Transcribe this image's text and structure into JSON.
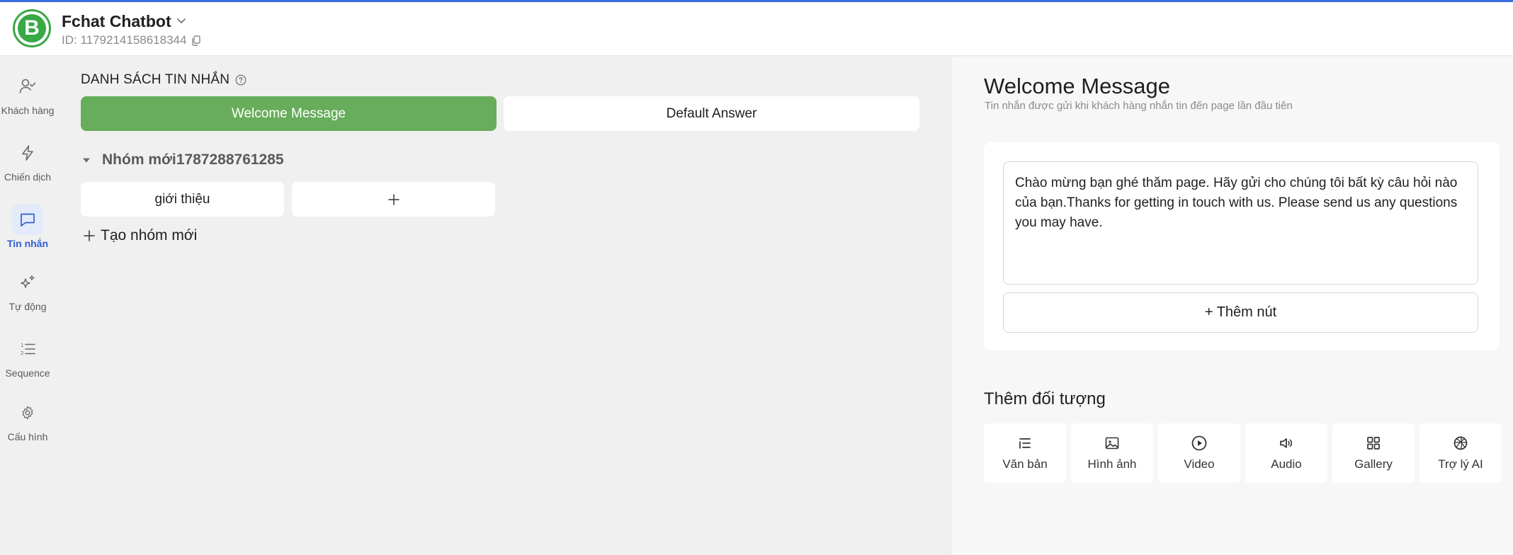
{
  "header": {
    "app_name": "Fchat Chatbot",
    "app_id": "ID: 1179214158618344",
    "logo_letter": "B"
  },
  "nav": {
    "items": [
      {
        "label": "Khách hàng",
        "icon": "user-check-icon",
        "active": false
      },
      {
        "label": "Chiến dịch",
        "icon": "lightning-icon",
        "active": false
      },
      {
        "label": "Tin nhắn",
        "icon": "message-icon",
        "active": true
      },
      {
        "label": "Tự động",
        "icon": "sparkles-icon",
        "active": false
      },
      {
        "label": "Sequence",
        "icon": "numbered-list-icon",
        "active": false
      },
      {
        "label": "Cấu hình",
        "icon": "gear-icon",
        "active": false
      }
    ]
  },
  "messages_panel": {
    "title": "DANH SÁCH TIN NHẮN",
    "tabs": [
      {
        "label": "Welcome Message",
        "active": true
      },
      {
        "label": "Default Answer",
        "active": false
      }
    ],
    "group": {
      "name": "Nhóm mới1787288761285",
      "items": [
        "giới thiệu"
      ]
    },
    "new_group_label": "Tạo nhóm mới"
  },
  "editor": {
    "title": "Welcome Message",
    "subtitle": "Tin nhắn được gửi khi khách hàng nhắn tin đến page lần đầu tiên",
    "message_text": "Chào mừng bạn ghé thăm page. Hãy gửi cho chúng tôi bất kỳ câu hỏi nào của bạn.Thanks for getting in touch with us. Please send us any questions you may have.",
    "add_button_label": "+ Thêm nút",
    "objects_title": "Thêm đối tượng",
    "objects": [
      {
        "label": "Văn bản",
        "icon": "text-icon"
      },
      {
        "label": "Hình ảnh",
        "icon": "image-icon"
      },
      {
        "label": "Video",
        "icon": "play-circle-icon"
      },
      {
        "label": "Audio",
        "icon": "speaker-icon"
      },
      {
        "label": "Gallery",
        "icon": "grid-icon"
      },
      {
        "label": "Trợ lý AI",
        "icon": "ai-assistant-icon"
      }
    ]
  },
  "colors": {
    "accent_green": "#67ad5b",
    "active_blue": "#2f5fd0",
    "top_line": "#3b6fe0"
  }
}
